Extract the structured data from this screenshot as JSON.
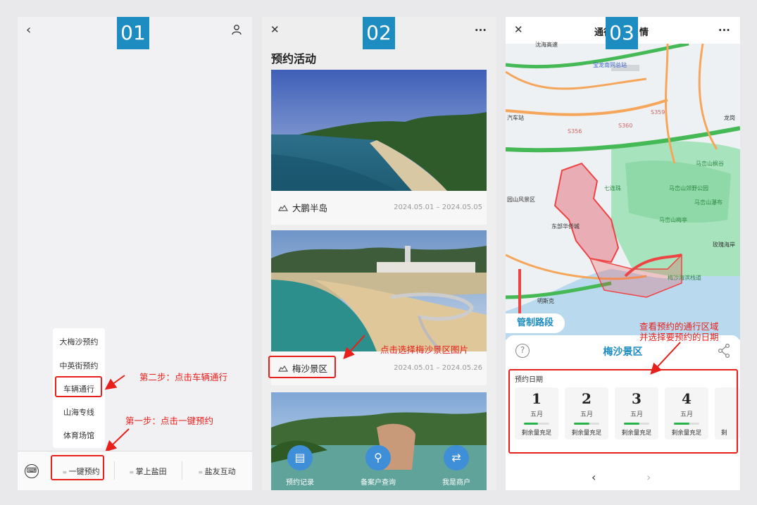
{
  "panel1": {
    "badge": "01",
    "back_icon": "‹",
    "user_icon": "user-icon",
    "menu_items": [
      "大梅沙预约",
      "中英街预约",
      "车辆通行",
      "山海专线",
      "体育场馆"
    ],
    "bottom_tabs": [
      "一键预约",
      "掌上盐田",
      "盐友互动"
    ],
    "annotation_step2": "第二步：点击车辆通行",
    "annotation_step1": "第一步：点击一键预约",
    "accent_color": "#e8201c"
  },
  "panel2": {
    "badge": "02",
    "close_icon": "✕",
    "more_icon": "···",
    "section_title": "预约活动",
    "cards": [
      {
        "name": "大鹏半岛",
        "date": "2024.05.01 – 2024.05.05"
      },
      {
        "name": "梅沙景区",
        "date": "2024.05.01 – 2024.05.26"
      }
    ],
    "annotation": "点击选择梅沙景区图片",
    "float_buttons": [
      "预约记录",
      "备案户查询",
      "我是商户"
    ],
    "accent_color": "#3f8fd8"
  },
  "panel3": {
    "badge": "03",
    "title_left": "通行",
    "title_right": "情",
    "close_icon": "✕",
    "more_icon": "···",
    "map_labels": [
      "宝龙南同总站",
      "马峦山枫谷",
      "马峦山郊野公园",
      "马峦山瀑布",
      "马峦山梅亭",
      "七连珠",
      "东部华侨城",
      "梅沙海滨栈道",
      "S356",
      "S359",
      "S360",
      "汽车站",
      "园山风景区",
      "龙岗",
      "沈海高速",
      "玫瑰海岸",
      "明斯克"
    ],
    "road_tag": "管制路段",
    "panel_title": "梅沙景区",
    "section_label": "预约日期",
    "dates": [
      {
        "day": "1",
        "month": "五月",
        "status": "剩余量充足",
        "fill": 0.55
      },
      {
        "day": "2",
        "month": "五月",
        "status": "剩余量充足",
        "fill": 0.6
      },
      {
        "day": "3",
        "month": "五月",
        "status": "剩余量充足",
        "fill": 0.6
      },
      {
        "day": "4",
        "month": "五月",
        "status": "剩余量充足",
        "fill": 0.6
      }
    ],
    "partial_status": "剩",
    "annotation_line1": "查看预约的通行区域",
    "annotation_line2": "并选择要预约的日期",
    "accent_color": "#1d8cc1"
  }
}
